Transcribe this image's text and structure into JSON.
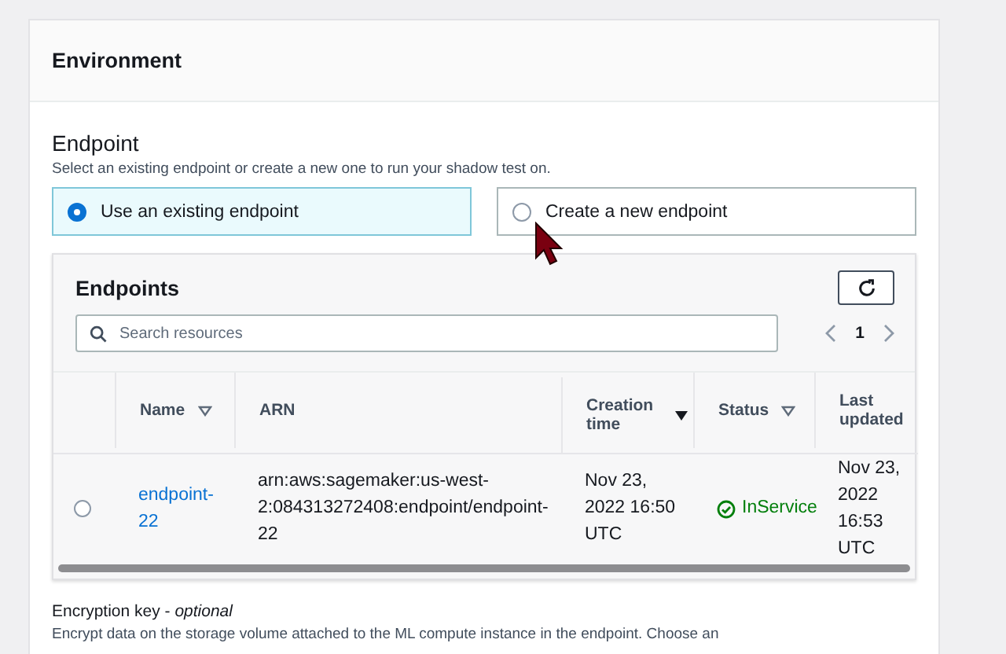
{
  "panel": {
    "title": "Environment"
  },
  "endpoint": {
    "title": "Endpoint",
    "description": "Select an existing endpoint or create a new one to run your shadow test on.",
    "options": [
      {
        "label": "Use an existing endpoint",
        "selected": true
      },
      {
        "label": "Create a new endpoint",
        "selected": false
      }
    ]
  },
  "endpoints_table": {
    "title": "Endpoints",
    "search": {
      "placeholder": "Search resources"
    },
    "pagination": {
      "page": "1"
    },
    "columns": [
      {
        "label": "Name",
        "sortable": true,
        "sorted_descending": false
      },
      {
        "label": "ARN",
        "sortable": false,
        "sorted_descending": false
      },
      {
        "label": "Creation time",
        "sortable": true,
        "sorted_descending": true
      },
      {
        "label": "Status",
        "sortable": true,
        "sorted_descending": false
      },
      {
        "label": "Last updated",
        "sortable": false,
        "sorted_descending": false
      }
    ],
    "rows": [
      {
        "selected": false,
        "name": "endpoint-22",
        "arn": "arn:aws:sagemaker:us-west-2:084313272408:endpoint/endpoint-22",
        "creation_time": "Nov 23, 2022 16:50 UTC",
        "status": "InService",
        "last_updated": "Nov 23, 2022 16:53 UTC"
      }
    ]
  },
  "encryption": {
    "label": "Encryption key - *optional*",
    "description": "Encrypt data on the storage volume attached to the ML compute instance in the endpoint. Choose an"
  }
}
